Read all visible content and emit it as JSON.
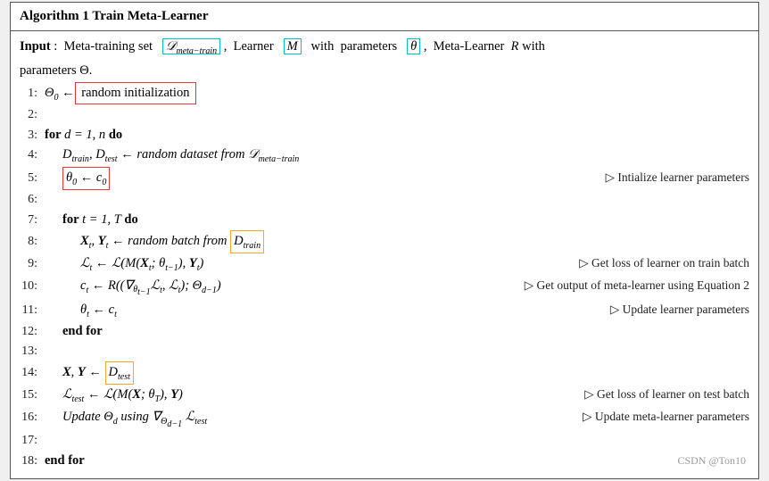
{
  "algorithm": {
    "title": "Algorithm 1 Train Meta-Learner",
    "input_label": "Input",
    "input_text_1": ": Meta-training set",
    "D_meta_train": "𝒟",
    "D_meta_train_sub": "meta−train",
    "input_text_2": ", Learner",
    "M_box": "M",
    "params_text": "with parameters",
    "theta_box": "θ",
    "input_text_3": ", Meta-Learner",
    "R_text": "R with",
    "params_theta": "parameters Θ.",
    "lines": [
      {
        "num": "1:",
        "content": "Θ₀ ← [random initialization]",
        "type": "init"
      },
      {
        "num": "2:",
        "content": "",
        "type": "empty"
      },
      {
        "num": "3:",
        "content": "for d = 1, n do",
        "type": "for-bold"
      },
      {
        "num": "4:",
        "content": "D_train, D_test ← random dataset from 𝒟_meta-train",
        "type": "dataset",
        "indent": 1
      },
      {
        "num": "5:",
        "content": "[θ₀ ← c₀]",
        "type": "theta-box",
        "indent": 1,
        "comment": "▷ Intialize learner parameters"
      },
      {
        "num": "6:",
        "content": "",
        "type": "empty"
      },
      {
        "num": "7:",
        "content": "for t = 1, T do",
        "type": "for-bold",
        "indent": 1
      },
      {
        "num": "8:",
        "content": "X_t, Y_t ← random batch from [D_train]",
        "type": "batch",
        "indent": 2,
        "comment": ""
      },
      {
        "num": "9:",
        "content": "ℒ_t ← ℒ(M(X_t; θ_{t−1}), Y_t)",
        "type": "math-line",
        "indent": 2,
        "comment": "▷ Get loss of learner on train batch"
      },
      {
        "num": "10:",
        "content": "c_t ← R((∇_{θ_{t−1}}ℒ_t, ℒ_t); Θ_{d−1})",
        "type": "math-line",
        "indent": 2,
        "comment": "▷ Get output of meta-learner using Equation 2"
      },
      {
        "num": "11:",
        "content": "θ_t ← c_t",
        "type": "math-line",
        "indent": 2,
        "comment": "▷ Update learner parameters"
      },
      {
        "num": "12:",
        "content": "end for",
        "type": "end-for-bold",
        "indent": 1
      },
      {
        "num": "13:",
        "content": "",
        "type": "empty"
      },
      {
        "num": "14:",
        "content": "X, Y ← [D_test]",
        "type": "xtest",
        "indent": 1,
        "comment": ""
      },
      {
        "num": "15:",
        "content": "ℒ_test ← ℒ(M(X; θ_T), Y)",
        "type": "math-line",
        "indent": 1,
        "comment": "▷ Get loss of learner on test batch"
      },
      {
        "num": "16:",
        "content": "Update Θ_d using ∇_{Θ_{d−1}} ℒ_test",
        "type": "math-line",
        "indent": 1,
        "comment": "▷ Update meta-learner parameters"
      },
      {
        "num": "17:",
        "content": "",
        "type": "empty"
      },
      {
        "num": "18:",
        "content": "end for",
        "type": "end-for-bold"
      }
    ],
    "watermark": "CSDN @Ton10"
  }
}
